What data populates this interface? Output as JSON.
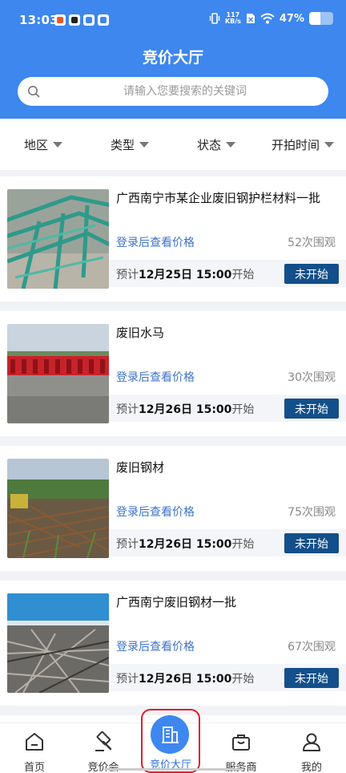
{
  "status_bar": {
    "time": "13:03",
    "net_speed_value": "117",
    "net_speed_unit": "KB/s",
    "battery": "47%"
  },
  "header": {
    "title": "竞价大厅"
  },
  "search": {
    "placeholder": "请输入您要搜索的关键词"
  },
  "filters": [
    {
      "label": "地区"
    },
    {
      "label": "类型"
    },
    {
      "label": "状态"
    },
    {
      "label": "开拍时间"
    }
  ],
  "items": [
    {
      "title": "广西南宁市某企业废旧钢护栏材料一批",
      "price_text": "登录后查看价格",
      "views": "52次围观",
      "time_prefix": "预计",
      "time_value": "12月25日 15:00",
      "time_suffix": "开始",
      "status": "未开始"
    },
    {
      "title": "废旧水马",
      "price_text": "登录后查看价格",
      "views": "30次围观",
      "time_prefix": "预计",
      "time_value": "12月26日 15:00",
      "time_suffix": "开始",
      "status": "未开始"
    },
    {
      "title": "废旧钢材",
      "price_text": "登录后查看价格",
      "views": "75次围观",
      "time_prefix": "预计",
      "time_value": "12月26日 15:00",
      "time_suffix": "开始",
      "status": "未开始"
    },
    {
      "title": "广西南宁废旧钢材一批",
      "price_text": "登录后查看价格",
      "views": "67次围观",
      "time_prefix": "预计",
      "time_value": "12月26日 15:00",
      "time_suffix": "开始",
      "status": "未开始"
    }
  ],
  "bottom_nav": [
    {
      "label": "首页",
      "icon": "home-icon"
    },
    {
      "label": "竞价会",
      "icon": "auction-hammer-icon"
    },
    {
      "label": "竞价大厅",
      "icon": "building-icon",
      "active": true
    },
    {
      "label": "服务商",
      "icon": "briefcase-icon"
    },
    {
      "label": "我的",
      "icon": "user-icon"
    }
  ],
  "colors": {
    "primary": "#3d87ee",
    "status_button": "#134f8a",
    "link": "#3d72c8",
    "highlight_border": "#e01e2b"
  }
}
